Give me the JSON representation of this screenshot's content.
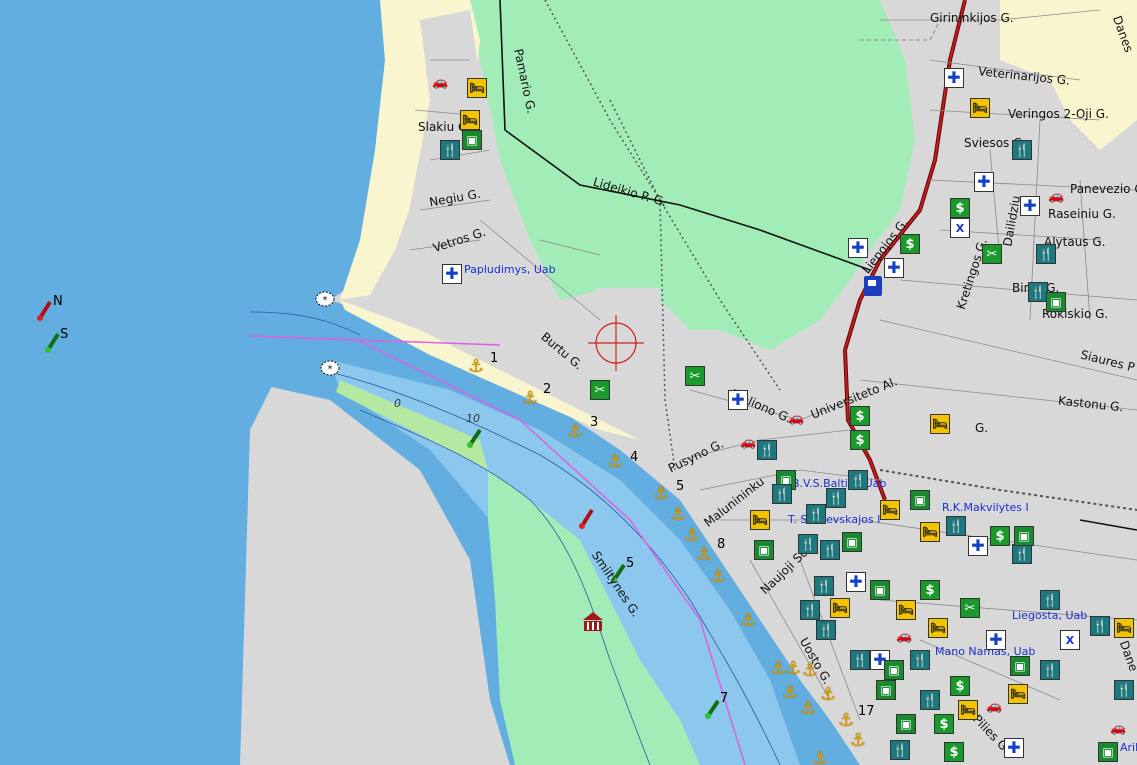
{
  "streets": {
    "girininkijos": "Girininkijos G.",
    "veterinarijos": "Veterinarijos G.",
    "veringos": "Veringos 2-Oji G.",
    "sviesos": "Sviesos G.",
    "panevezio": "Panevezio G.",
    "raseiniu": "Raseiniu G.",
    "alytaus": "Alytaus G.",
    "birzu": "Birzu G.",
    "rokiskio": "Rokiskio G.",
    "siaures": "Siaures P",
    "kastonu": "Kastonu G.",
    "pamario": "Pamario G.",
    "slakiu": "Slakiu G.",
    "negiu": "Negiu G.",
    "vetros": "Vetros G.",
    "lideikio": "Lideikio P. G.",
    "liepojos": "Liepojos G.",
    "kretingos": "Kretingos G.",
    "dailidziu": "Dailidziu",
    "burtu": "Burtu G.",
    "stoliono": "Stoliono G.",
    "universiteto": "Universiteto Al.",
    "pusyno": "Pusyno G.",
    "malunininku": "Malunininku",
    "naujoji_sodo": "Naujoji Sodo",
    "smiltynes": "Smiltynes G.",
    "uosto": "Uosto G.",
    "pilies": "Pilies G.",
    "dane": "Danes",
    "dane_right": "Dane",
    "g_right": "G.",
    "misc_g": "G."
  },
  "businesses": {
    "papludimys": "Papludimys, Uab",
    "bvs_baltija": "B.V.S.Baltija, Uab",
    "rk_makvilytes": "R.K.Makvilytes I",
    "t_suscevskajos": "T. Suscevskajos I",
    "liegosta": "Liegosta, Uab",
    "mano_namas": "Mano Namas, Uab",
    "arib": "Arib"
  },
  "markers": {
    "north": "N",
    "south": "S",
    "buoy_numbers": [
      "1",
      "2",
      "3",
      "4",
      "5",
      "7",
      "8",
      "17"
    ],
    "depth_labels": [
      "0",
      "10"
    ]
  },
  "colors": {
    "sea": "#62aee0",
    "channel": "#8cc7ee",
    "forest": "#a2ecb8",
    "land": "#d8d8d8",
    "beach": "#f8f5cf",
    "road_main": "#a01818",
    "route_pink": "#e060e0",
    "rail": "#555555"
  },
  "icons": {
    "crosshair": "crosshair-icon",
    "anchor": "anchor-icon",
    "hospital": "hospital-icon",
    "bank": "bank-icon",
    "restaurant": "restaurant-icon",
    "hotel": "hotel-icon",
    "fuel": "fuel-icon",
    "museum": "museum-icon",
    "car": "car-icon"
  }
}
